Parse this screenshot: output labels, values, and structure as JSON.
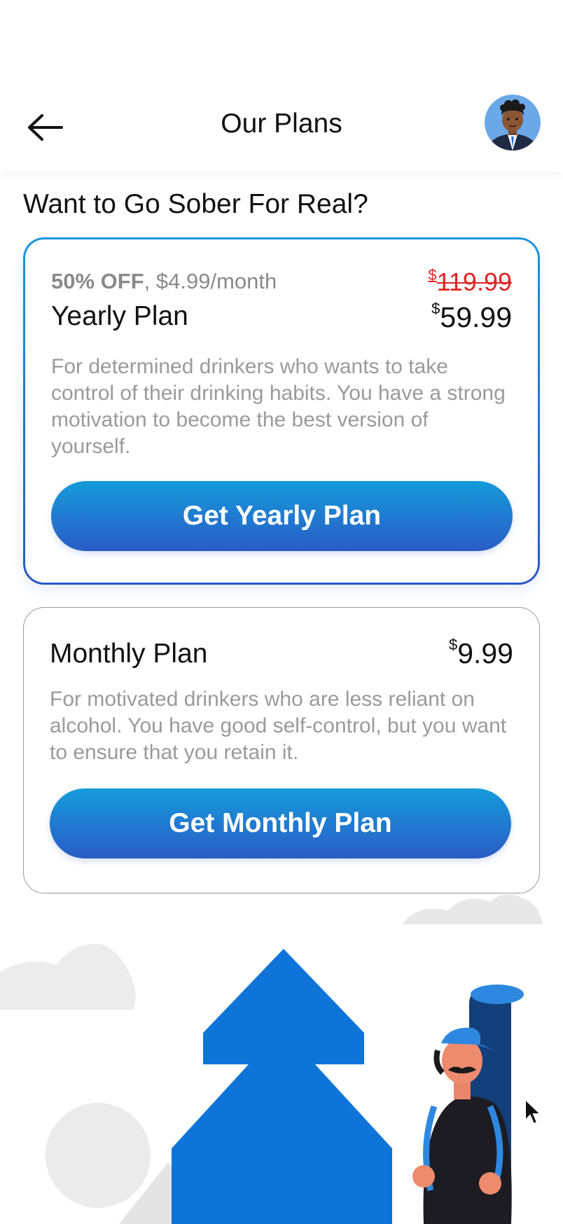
{
  "header": {
    "title": "Our Plans",
    "back_icon": "arrow-left-icon",
    "avatar_icon": "user-avatar"
  },
  "heading": "Want to Go Sober For Real?",
  "plans": [
    {
      "discount": "50% OFF",
      "per_month": ", $4.99/month",
      "old_price_symbol": "$",
      "old_price": "119.99",
      "name": "Yearly Plan",
      "price_symbol": "$",
      "price": "59.99",
      "description": "For determined drinkers who wants to take control of their drinking habits. You have a strong motivation to become the best version of yourself.",
      "cta_label": "Get Yearly Plan"
    },
    {
      "name": "Monthly Plan",
      "price_symbol": "$",
      "price": "9.99",
      "description": "For motivated drinkers who are less reliant on alcohol. You have good self-control, but you want to ensure that you retain it.",
      "cta_label": "Get Monthly Plan"
    }
  ],
  "colors": {
    "accent_gradient_start": "#159bdb",
    "accent_gradient_end": "#2a5cc6",
    "discount_price": "#e02424",
    "muted_text": "#9a9a9a",
    "tree_blue": "#0f74d8"
  }
}
